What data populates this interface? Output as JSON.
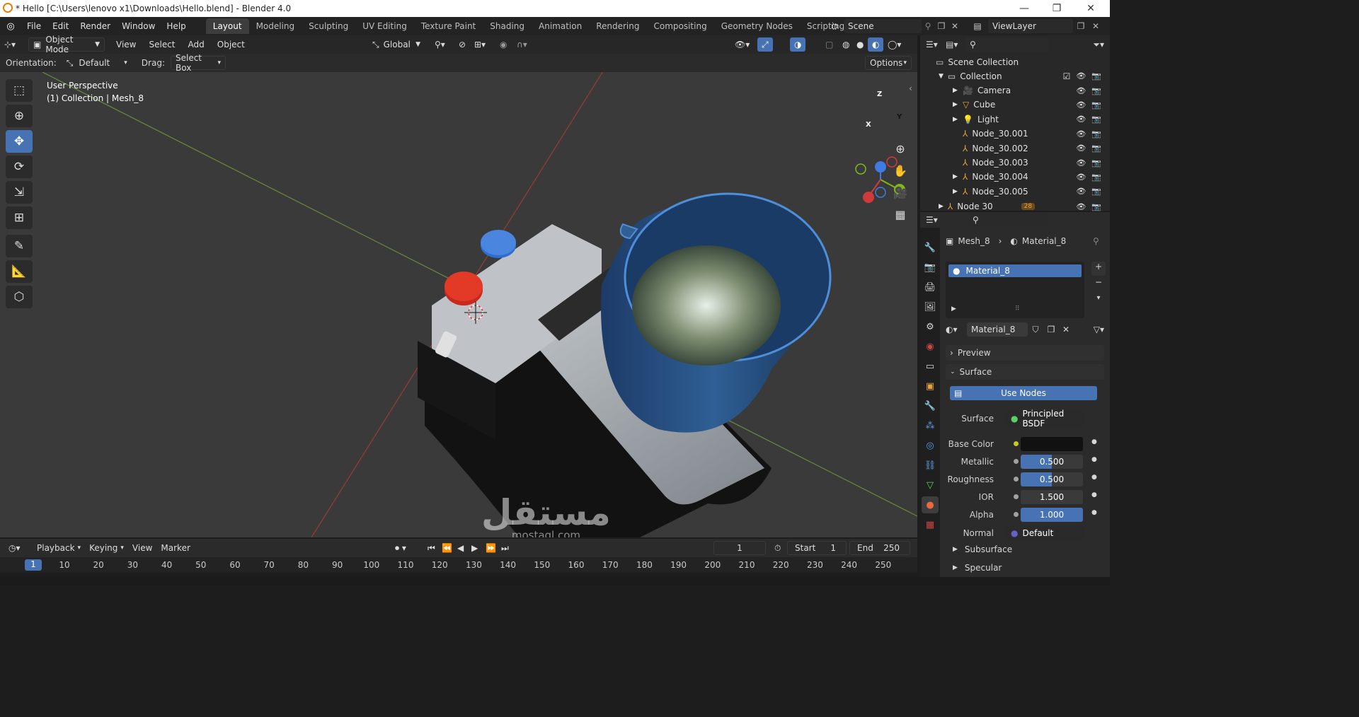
{
  "window": {
    "title": "* Hello [C:\\Users\\lenovo x1\\Downloads\\Hello.blend] - Blender 4.0",
    "controls": [
      "—",
      "❐",
      "✕"
    ]
  },
  "menu": [
    "File",
    "Edit",
    "Render",
    "Window",
    "Help"
  ],
  "workspaces": [
    "Layout",
    "Modeling",
    "Sculpting",
    "UV Editing",
    "Texture Paint",
    "Shading",
    "Animation",
    "Rendering",
    "Compositing",
    "Geometry Nodes",
    "Scripting"
  ],
  "active_workspace": "Layout",
  "scene": {
    "name": "Scene",
    "view_layer": "ViewLayer"
  },
  "viewport_header": {
    "mode": "Object Mode",
    "menus": [
      "View",
      "Select",
      "Add",
      "Object"
    ],
    "transform_orientation": "Global"
  },
  "tool_settings": {
    "orientation_label": "Orientation:",
    "orientation_value": "Default",
    "drag_label": "Drag:",
    "drag_value": "Select Box",
    "options": "Options"
  },
  "viewport": {
    "perspective": "User Perspective",
    "context": "(1) Collection | Mesh_8",
    "axes": {
      "x": "X",
      "y": "Y",
      "z": "Z"
    },
    "watermark_arabic": "مستقل",
    "watermark_latin": "mostaql.com"
  },
  "outliner": {
    "root": "Scene Collection",
    "collection": "Collection",
    "items": [
      {
        "name": "Camera",
        "icon": "camera-icon",
        "color": "#e8a33d"
      },
      {
        "name": "Cube",
        "icon": "mesh-icon",
        "color": "#e8a33d"
      },
      {
        "name": "Light",
        "icon": "light-icon",
        "color": "#e8a33d"
      },
      {
        "name": "Node_30.001",
        "icon": "empty-icon",
        "color": "#e8a33d"
      },
      {
        "name": "Node_30.002",
        "icon": "empty-icon",
        "color": "#e8a33d"
      },
      {
        "name": "Node_30.003",
        "icon": "empty-icon",
        "color": "#e8a33d"
      },
      {
        "name": "Node_30.004",
        "icon": "empty-icon",
        "color": "#e8a33d"
      },
      {
        "name": "Node_30.005",
        "icon": "empty-icon",
        "color": "#e8a33d"
      }
    ],
    "last": "Node 30",
    "last_badge": "28"
  },
  "properties": {
    "breadcrumb_object": "Mesh_8",
    "breadcrumb_material": "Material_8",
    "slot": "Material_8",
    "material_name": "Material_8",
    "preview_label": "Preview",
    "surface_label": "Surface",
    "use_nodes": "Use Nodes",
    "surface_field_label": "Surface",
    "surface_shader": "Principled BSDF",
    "base_color_label": "Base Color",
    "base_color": "#111111",
    "metallic_label": "Metallic",
    "metallic": "0.500",
    "roughness_label": "Roughness",
    "roughness": "0.500",
    "ior_label": "IOR",
    "ior": "1.500",
    "alpha_label": "Alpha",
    "alpha": "1.000",
    "normal_label": "Normal",
    "normal": "Default",
    "subsurface": "Subsurface",
    "specular": "Specular"
  },
  "timeline": {
    "menus": [
      "Playback",
      "Keying",
      "View",
      "Marker"
    ],
    "current_frame": "1",
    "start_label": "Start",
    "start": "1",
    "end_label": "End",
    "end": "250",
    "frame_marker": "1",
    "ticks": [
      "10",
      "20",
      "30",
      "40",
      "50",
      "60",
      "70",
      "80",
      "90",
      "100",
      "110",
      "120",
      "130",
      "140",
      "150",
      "160",
      "170",
      "180",
      "190",
      "200",
      "210",
      "220",
      "230",
      "240",
      "250"
    ]
  },
  "colors": {
    "accent": "#4772b3",
    "x_axis": "#d13a3a",
    "y_axis": "#7fb81c",
    "z_axis": "#3f7be0"
  }
}
